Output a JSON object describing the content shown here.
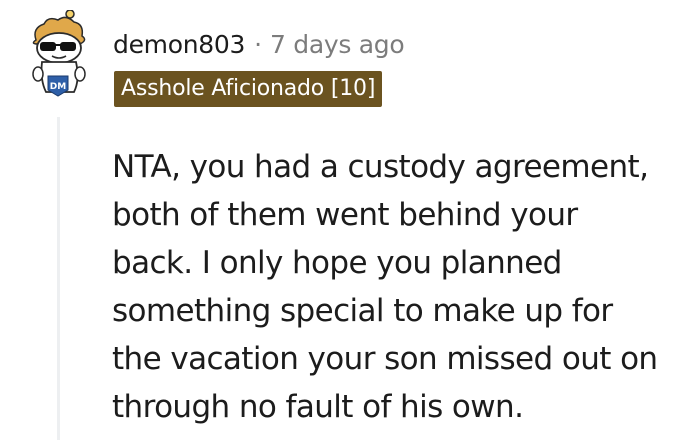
{
  "comment": {
    "author": "demon803",
    "separator": "·",
    "timestamp": "7 days ago",
    "flair": "Asshole Aficionado [10]",
    "avatar_icon": "snoo-avatar-icon",
    "avatar_badge_text": "DM",
    "flair_color": "#6b5320",
    "body_lines": [
      "NTA, you had a custody agreement,",
      "both of them went behind your",
      "back. I only hope you planned",
      "something special to make up for",
      "the vacation your son missed out on",
      "through no fault of his own."
    ]
  }
}
